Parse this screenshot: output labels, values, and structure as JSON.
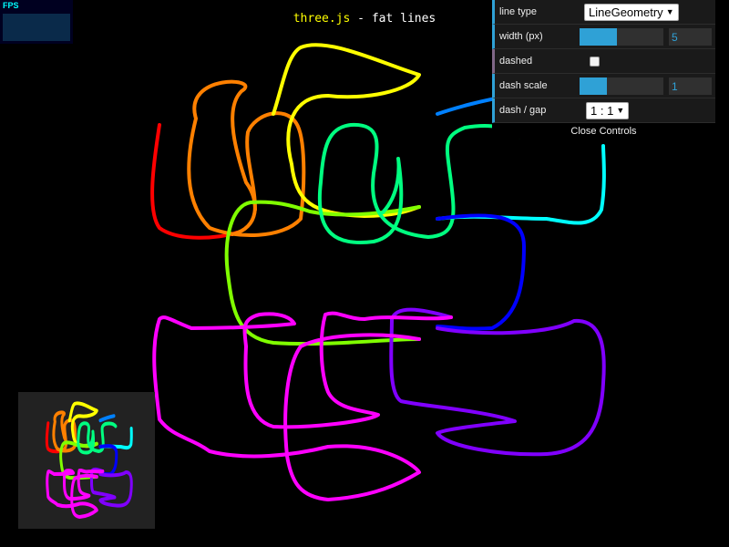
{
  "page": {
    "title_link": "three.js",
    "title_rest": " - fat lines"
  },
  "fps": {
    "label": "FPS"
  },
  "gui": {
    "rows": [
      {
        "label": "line type",
        "value": "LineGeometry"
      },
      {
        "label": "width (px)",
        "value": "5",
        "fraction": 0.45
      },
      {
        "label": "dashed",
        "checked": false
      },
      {
        "label": "dash scale",
        "value": "1",
        "fraction": 0.33
      },
      {
        "label": "dash / gap",
        "value": "1 : 1"
      }
    ],
    "close_label": "Close Controls"
  },
  "colors": {
    "background": "#000000",
    "gui_accent": "#2fa1d6",
    "title_link": "#ffff00",
    "line_gradient": [
      "#ff0000",
      "#ff8000",
      "#ffff00",
      "#80ff00",
      "#00ff80",
      "#00ffff",
      "#0080ff",
      "#0000ff",
      "#8000ff",
      "#ff00ff"
    ]
  },
  "icons": {
    "select_arrow": "▼"
  }
}
